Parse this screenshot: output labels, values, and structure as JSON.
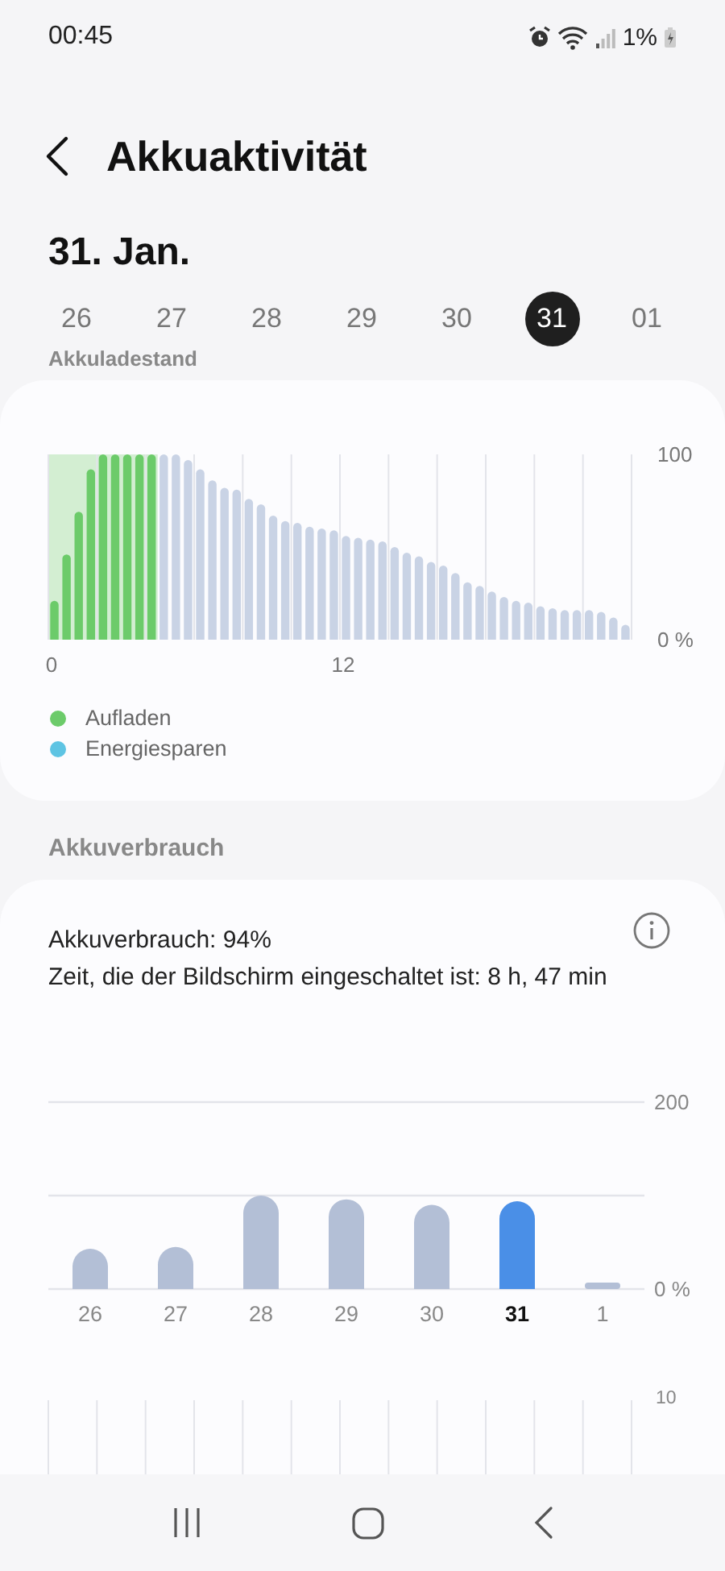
{
  "status_bar": {
    "time": "00:45",
    "battery": "1%"
  },
  "header": {
    "title": "Akkuaktivität"
  },
  "date_title": "31. Jan.",
  "dates": [
    {
      "label": "26",
      "selected": false
    },
    {
      "label": "27",
      "selected": false
    },
    {
      "label": "28",
      "selected": false
    },
    {
      "label": "29",
      "selected": false
    },
    {
      "label": "30",
      "selected": false
    },
    {
      "label": "31",
      "selected": true
    },
    {
      "label": "01",
      "selected": false
    }
  ],
  "level_section": {
    "heading": "Akkuladestand",
    "chart_data": {
      "type": "bar",
      "x": [
        0.25,
        0.75,
        1.25,
        1.75,
        2.25,
        2.75,
        3.25,
        3.75,
        4.25,
        4.75,
        5.25,
        5.75,
        6.25,
        6.75,
        7.25,
        7.75,
        8.25,
        8.75,
        9.25,
        9.75,
        10.25,
        10.75,
        11.25,
        11.75,
        12.25,
        12.75,
        13.25,
        13.75,
        14.25,
        14.75,
        15.25,
        15.75,
        16.25,
        16.75,
        17.25,
        17.75,
        18.25,
        18.75,
        19.25,
        19.75,
        20.25,
        20.75,
        21.25,
        21.75,
        22.25,
        22.75,
        23.25,
        23.75
      ],
      "bands": [
        {
          "axis": "x",
          "from": 0,
          "to": 4.5,
          "color": "#d3eed2"
        }
      ],
      "xlim": [
        0,
        24
      ],
      "ylim": [
        0,
        100
      ],
      "xticks": [
        {
          "value": 0,
          "label": "0"
        },
        {
          "value": 12,
          "label": "12"
        }
      ],
      "yticks": [
        {
          "value": 0,
          "label": "0 %"
        },
        {
          "value": 100,
          "label": "100"
        }
      ],
      "series": [
        {
          "name": "Aufladen",
          "color": "#6ccb6a",
          "values": [
            21,
            46,
            69,
            92,
            100,
            100,
            100,
            100,
            100,
            null,
            null,
            null,
            null,
            null,
            null,
            null,
            null,
            null,
            null,
            null,
            null,
            null,
            null,
            null,
            null,
            null,
            null,
            null,
            null,
            null,
            null,
            null,
            null,
            null,
            null,
            null,
            null,
            null,
            null,
            null,
            null,
            null,
            null,
            null,
            null,
            null,
            null,
            null
          ]
        },
        {
          "color": "#c9d3e5",
          "values": [
            null,
            null,
            null,
            null,
            null,
            null,
            null,
            null,
            null,
            100,
            100,
            97,
            92,
            86,
            82,
            81,
            76,
            73,
            67,
            64,
            63,
            61,
            60,
            59,
            56,
            55,
            54,
            53,
            50,
            47,
            45,
            42,
            40,
            36,
            31,
            29,
            26,
            23,
            21,
            20,
            18,
            17,
            16,
            16,
            16,
            15,
            12,
            8
          ]
        },
        {
          "name": "Energiesparen",
          "color": "#5ec4e3",
          "values": [
            null,
            null,
            null,
            null,
            null,
            null,
            null,
            null,
            null,
            null,
            null,
            null,
            null,
            null,
            null,
            null,
            null,
            null,
            null,
            null,
            null,
            null,
            null,
            null,
            null,
            null,
            null,
            null,
            null,
            null,
            null,
            null,
            null,
            null,
            null,
            null,
            null,
            null,
            null,
            null,
            null,
            null,
            null,
            null,
            null,
            null,
            null,
            null
          ]
        }
      ]
    }
  },
  "usage_section": {
    "heading": "Akkuverbrauch",
    "summary": "Akkuverbrauch: 94%",
    "screen_time": "Zeit, die der Bildschirm eingeschaltet ist: 8 h, 47 min",
    "chart_data": {
      "type": "bar",
      "categories": [
        "26",
        "27",
        "28",
        "29",
        "30",
        "31",
        "1"
      ],
      "ylim": [
        0,
        200
      ],
      "yticks": [
        {
          "value": 0,
          "label": "0 %"
        },
        {
          "value": 200,
          "label": "200"
        }
      ],
      "ref_lines": [
        {
          "axis": "y",
          "value": 100
        }
      ],
      "series": [
        {
          "color": "#b3bfd6",
          "values": [
            43,
            45,
            100,
            96,
            90,
            null,
            7
          ]
        },
        {
          "color": "#4a8fe7",
          "values": [
            null,
            null,
            null,
            null,
            null,
            94,
            null
          ]
        }
      ]
    },
    "day_states": [
      {
        "selected": false
      },
      {
        "selected": false
      },
      {
        "selected": false
      },
      {
        "selected": false
      },
      {
        "selected": false
      },
      {
        "selected": true
      },
      {
        "selected": false
      }
    ],
    "next_chart_tick": "10"
  }
}
